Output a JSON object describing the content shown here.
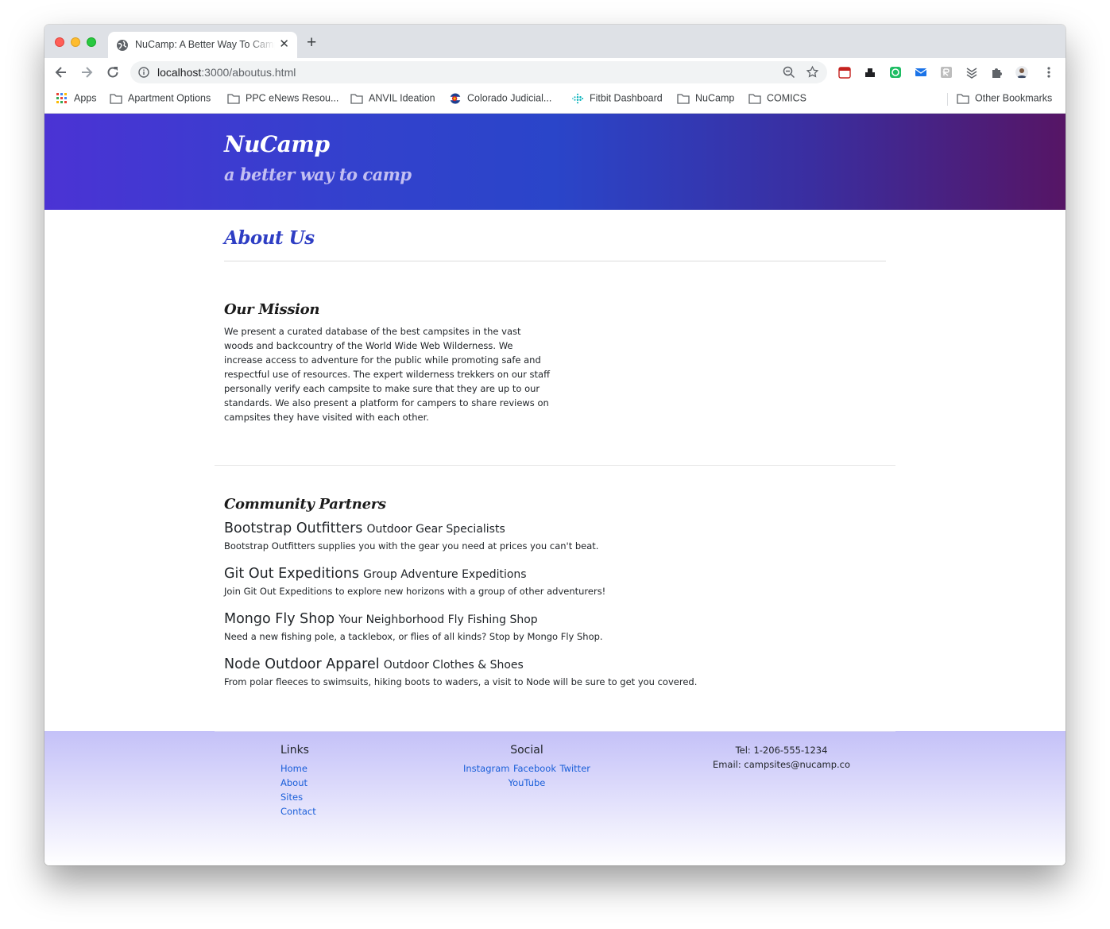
{
  "browser": {
    "tab_title": "NuCamp: A Better Way To Camp",
    "url_host": "localhost",
    "url_rest": ":3000/aboutus.html",
    "bookmarks": [
      {
        "label": "Apps",
        "icon": "apps-grid-icon"
      },
      {
        "label": "Apartment Options",
        "icon": "folder-icon"
      },
      {
        "label": "PPC eNews Resou...",
        "icon": "folder-icon"
      },
      {
        "label": "ANVIL Ideation",
        "icon": "folder-icon"
      },
      {
        "label": "Colorado Judicial...",
        "icon": "colorado-flag-icon"
      },
      {
        "label": "Fitbit Dashboard",
        "icon": "fitbit-icon"
      },
      {
        "label": "NuCamp",
        "icon": "folder-icon"
      },
      {
        "label": "COMICS",
        "icon": "folder-icon"
      }
    ],
    "other_bookmarks": "Other Bookmarks"
  },
  "site": {
    "brand": "NuCamp",
    "tagline": "a better way to camp"
  },
  "about": {
    "title": "About Us",
    "mission_title": "Our Mission",
    "mission_text": "We present a curated database of the best campsites in the vast woods and backcountry of the World Wide Web Wilderness. We increase access to adventure for the public while promoting safe and respectful use of resources. The expert wilderness trekkers on our staff personally verify each campsite to make sure that they are up to our standards. We also present a platform for campers to share reviews on campsites they have visited with each other."
  },
  "partners": {
    "title": "Community Partners",
    "items": [
      {
        "name": "Bootstrap Outfitters",
        "tagline": "Outdoor Gear Specialists",
        "description": "Bootstrap Outfitters supplies you with the gear you need at prices you can't beat."
      },
      {
        "name": "Git Out Expeditions",
        "tagline": "Group Adventure Expeditions",
        "description": "Join Git Out Expeditions to explore new horizons with a group of other adventurers!"
      },
      {
        "name": "Mongo Fly Shop",
        "tagline": "Your Neighborhood Fly Fishing Shop",
        "description": "Need a new fishing pole, a tacklebox, or flies of all kinds? Stop by Mongo Fly Shop."
      },
      {
        "name": "Node Outdoor Apparel",
        "tagline": "Outdoor Clothes & Shoes",
        "description": "From polar fleeces to swimsuits, hiking boots to waders, a visit to Node will be sure to get you covered."
      }
    ]
  },
  "footer": {
    "links_heading": "Links",
    "links": [
      "Home",
      "About",
      "Sites",
      "Contact"
    ],
    "social_heading": "Social",
    "social": [
      "Instagram",
      "Facebook",
      "Twitter",
      "YouTube"
    ],
    "tel": "Tel: 1-206-555-1234",
    "email": "Email: campsites@nucamp.co"
  },
  "colors": {
    "accent": "#2e3ec4",
    "link": "#1a5fd9",
    "header_gradient_start": "#4b33d4",
    "header_gradient_end": "#561565",
    "footer_gradient_start": "#c4c1f8"
  }
}
